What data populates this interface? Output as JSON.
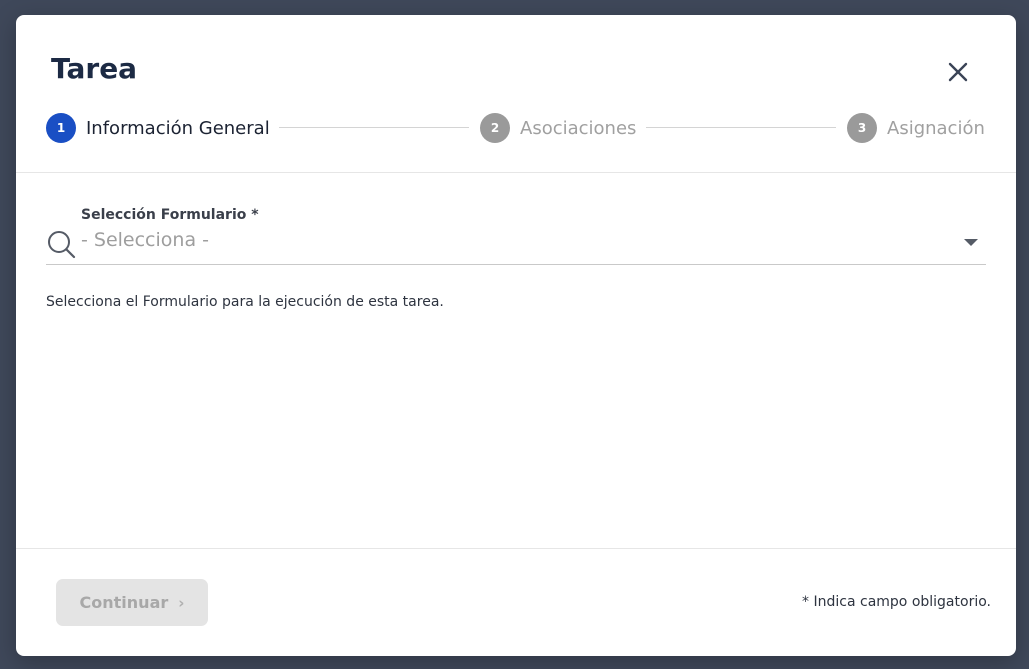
{
  "dialog": {
    "title": "Tarea",
    "close_icon": "close-icon"
  },
  "stepper": {
    "steps": [
      {
        "number": "1",
        "label": "Información General",
        "state": "active"
      },
      {
        "number": "2",
        "label": "Asociaciones",
        "state": "inactive"
      },
      {
        "number": "3",
        "label": "Asignación",
        "state": "inactive"
      }
    ]
  },
  "form": {
    "field_label": "Selección Formulario *",
    "field_value": "- Selecciona -",
    "field_icon": "search-icon",
    "caret_icon": "caret-down-icon",
    "helper_text": "Selecciona el Formulario para la ejecución de esta tarea."
  },
  "footer": {
    "continue_label": "Continuar",
    "continue_icon": "chevron-right-icon",
    "required_note": "* Indica campo obligatorio."
  },
  "colors": {
    "accent": "#1a4fc4",
    "inactive_step": "#9a9a9a",
    "title": "#1c2a44",
    "backdrop": "#3f485a"
  }
}
